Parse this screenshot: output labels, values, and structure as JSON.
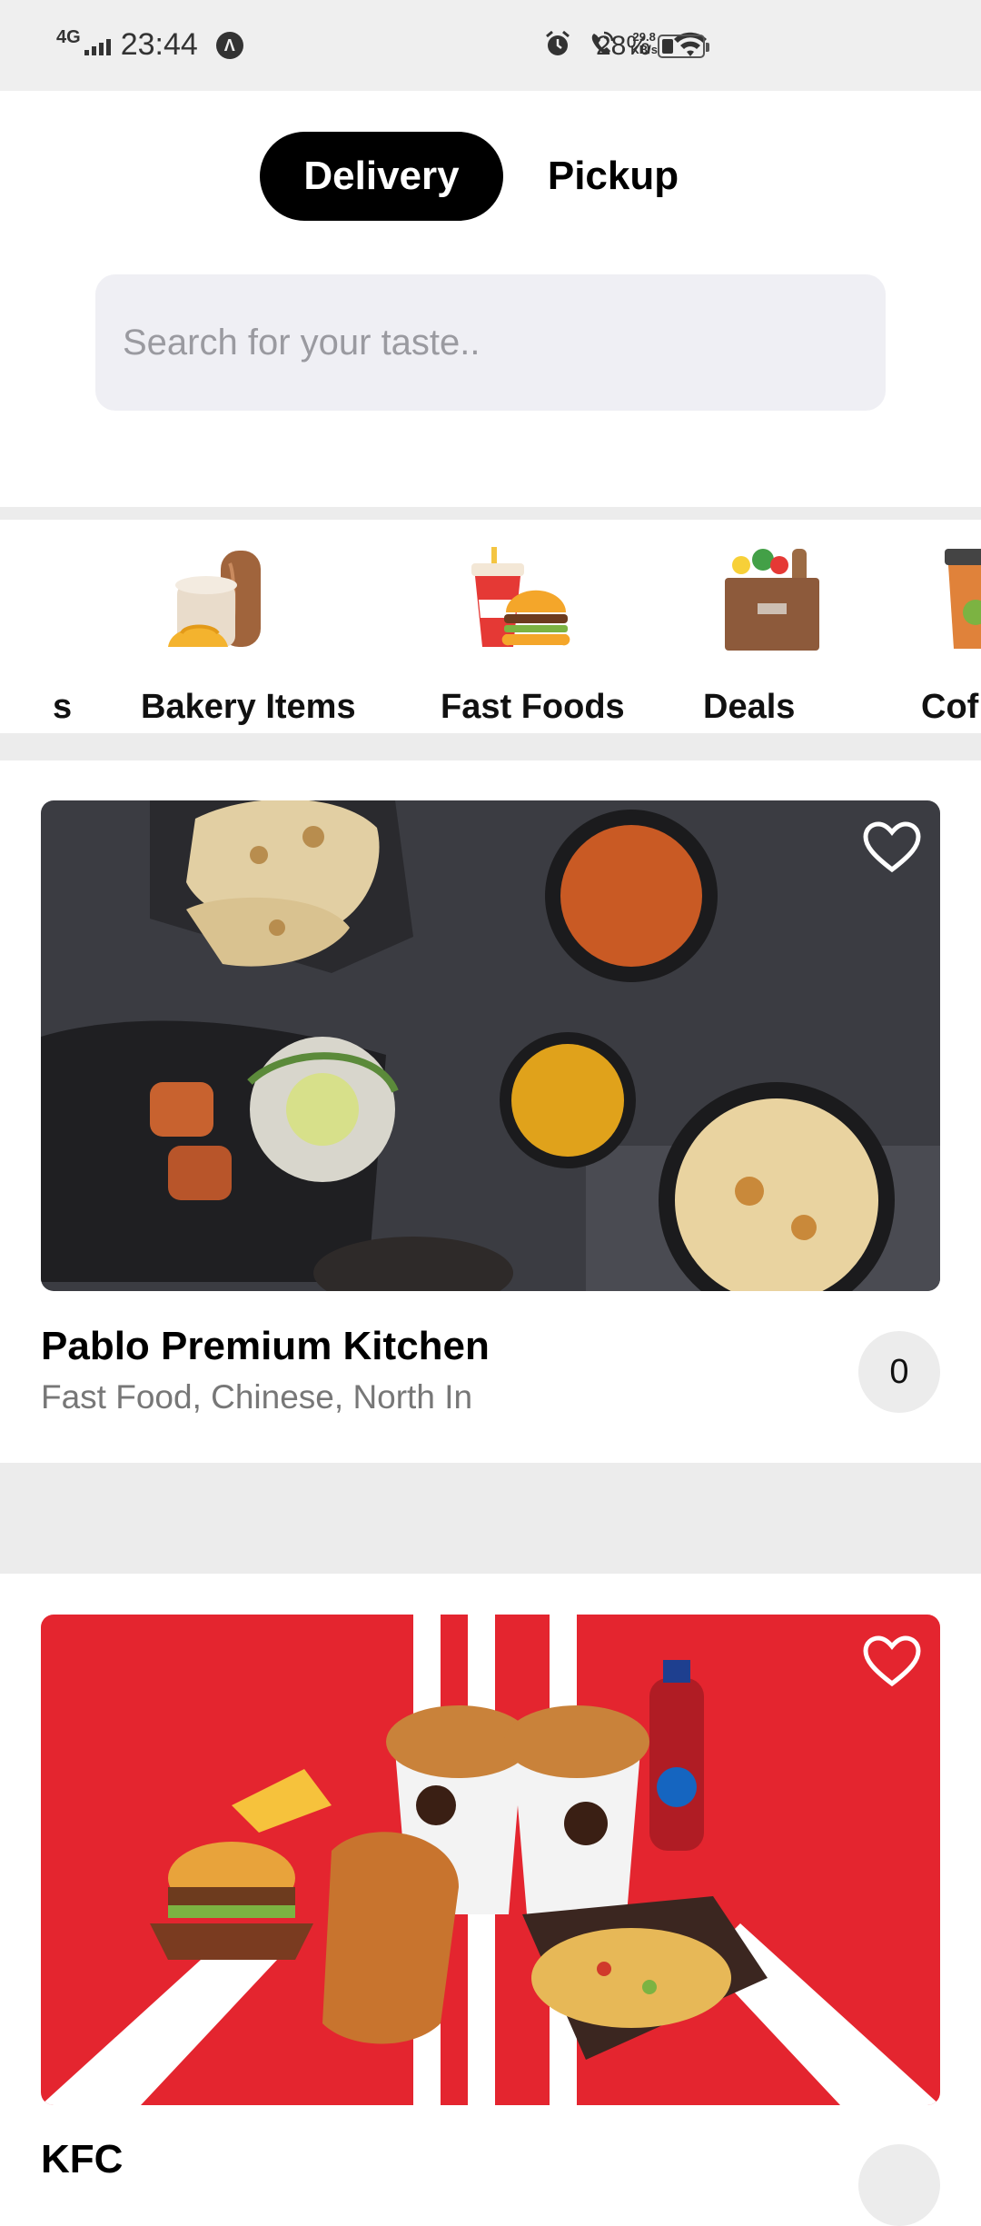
{
  "status_bar": {
    "network": "4G",
    "time": "23:44",
    "speed_value": "29.8",
    "speed_unit": "KB/s",
    "battery_percent": "28%",
    "battery_level": 0.28
  },
  "order_mode": {
    "delivery_label": "Delivery",
    "pickup_label": "Pickup",
    "selected": "Delivery"
  },
  "search": {
    "placeholder": "Search for your taste.."
  },
  "categories": [
    {
      "label": "s",
      "icon": "partial-category-icon"
    },
    {
      "label": "Bakery Items",
      "icon": "bakery-icon"
    },
    {
      "label": "Fast Foods",
      "icon": "fast-food-icon"
    },
    {
      "label": "Deals",
      "icon": "grocery-bag-icon"
    },
    {
      "label": "Cof",
      "icon": "coffee-cup-icon"
    }
  ],
  "restaurants": [
    {
      "name": "Pablo Premium Kitchen",
      "cuisines": "Fast Food, Chinese, North In",
      "count": "0",
      "image": "indian-food-spread-image"
    },
    {
      "name": "KFC",
      "image": "kfc-bucket-meal-image"
    }
  ],
  "colors": {
    "accent": "#000000",
    "kfc_red": "#e4252f",
    "divider": "#ececec",
    "search_bg": "#efeff4"
  }
}
